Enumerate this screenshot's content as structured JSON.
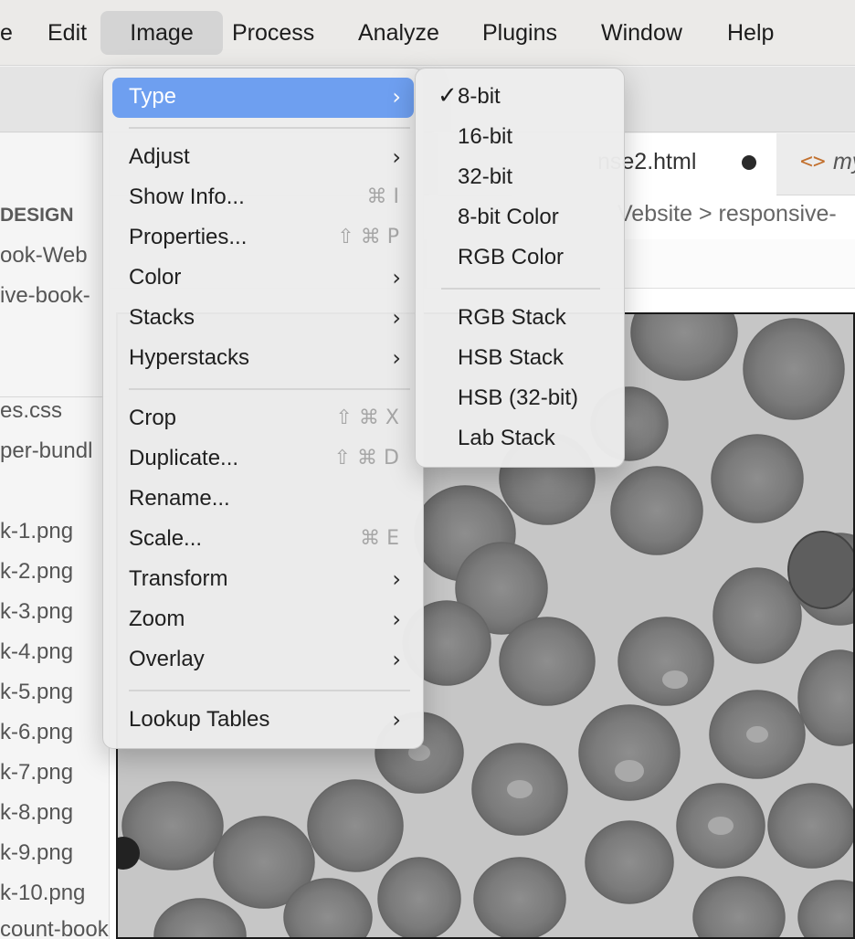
{
  "menubar": {
    "items": [
      "e",
      "Edit",
      "Image",
      "Process",
      "Analyze",
      "Plugins",
      "Window",
      "Help"
    ],
    "active": "Image"
  },
  "sidebar": {
    "heading": "DESIGN",
    "lines_top": [
      "ook-Web",
      "ive-book-"
    ],
    "files": [
      "es.css",
      "per-bundl",
      "k-1.png",
      "k-2.png",
      "k-3.png",
      "k-4.png",
      "k-5.png",
      "k-6.png",
      "k-7.png",
      "k-8.png",
      "k-9.png",
      "k-10.png",
      "count-book"
    ]
  },
  "editor": {
    "active_tab": "nse2.html",
    "tab_truncated": "my",
    "code_icon": "<>",
    "breadcrumb": "Vebsite > responsive-"
  },
  "image_menu": {
    "items": [
      {
        "label": "Type",
        "submenu": true,
        "shortcut": "",
        "highlighted": true
      },
      {
        "label": "Adjust",
        "submenu": true,
        "shortcut": ""
      },
      {
        "label": "Show Info...",
        "submenu": false,
        "shortcut": "⌘ I"
      },
      {
        "label": "Properties...",
        "submenu": false,
        "shortcut": "⇧ ⌘ P"
      },
      {
        "label": "Color",
        "submenu": true,
        "shortcut": ""
      },
      {
        "label": "Stacks",
        "submenu": true,
        "shortcut": ""
      },
      {
        "label": "Hyperstacks",
        "submenu": true,
        "shortcut": ""
      },
      {
        "label": "Crop",
        "submenu": false,
        "shortcut": "⇧ ⌘ X"
      },
      {
        "label": "Duplicate...",
        "submenu": false,
        "shortcut": "⇧ ⌘ D"
      },
      {
        "label": "Rename...",
        "submenu": false,
        "shortcut": ""
      },
      {
        "label": "Scale...",
        "submenu": false,
        "shortcut": "⌘ E"
      },
      {
        "label": "Transform",
        "submenu": true,
        "shortcut": ""
      },
      {
        "label": "Zoom",
        "submenu": true,
        "shortcut": ""
      },
      {
        "label": "Overlay",
        "submenu": true,
        "shortcut": ""
      },
      {
        "label": "Lookup Tables",
        "submenu": true,
        "shortcut": ""
      }
    ],
    "chevron": "›"
  },
  "type_submenu": {
    "items": [
      "8-bit",
      "16-bit",
      "32-bit",
      "8-bit Color",
      "RGB Color",
      "RGB Stack",
      "HSB Stack",
      "HSB (32-bit)",
      "Lab Stack"
    ],
    "checked": "8-bit",
    "check_glyph": "✓"
  },
  "colors": {
    "menu_highlight": "#6e9ff0",
    "cell_fill": "#7c7c7c",
    "image_background": "#c4c4c4"
  }
}
